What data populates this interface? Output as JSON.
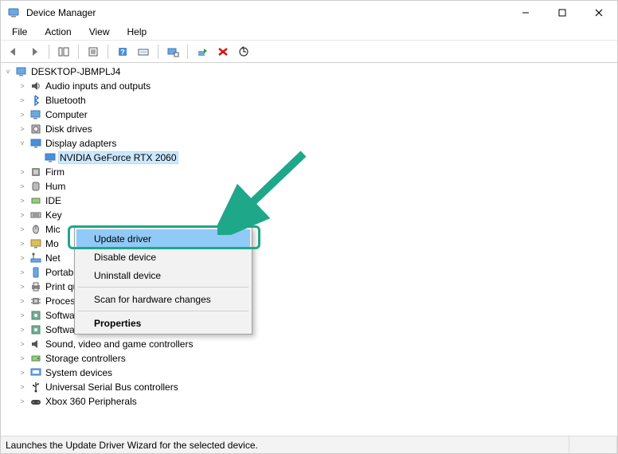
{
  "window": {
    "title": "Device Manager"
  },
  "menu": {
    "items": [
      "File",
      "Action",
      "View",
      "Help"
    ]
  },
  "toolbar": {
    "buttons": [
      {
        "name": "back-icon"
      },
      {
        "name": "forward-icon"
      },
      {
        "sep": true
      },
      {
        "name": "up-icon"
      },
      {
        "sep": true
      },
      {
        "name": "properties-icon"
      },
      {
        "sep": true
      },
      {
        "name": "help-icon"
      },
      {
        "name": "devices-icon"
      },
      {
        "sep": true
      },
      {
        "name": "scan-icon"
      },
      {
        "sep": true
      },
      {
        "name": "add-legacy-icon"
      },
      {
        "name": "uninstall-icon"
      },
      {
        "name": "update-driver-icon"
      }
    ]
  },
  "tree": {
    "root": {
      "label": "DESKTOP-JBMPLJ4",
      "icon": "computer-icon",
      "expanded": true,
      "children": [
        {
          "label": "Audio inputs and outputs",
          "icon": "audio-icon"
        },
        {
          "label": "Bluetooth",
          "icon": "bluetooth-icon"
        },
        {
          "label": "Computer",
          "icon": "computer-icon"
        },
        {
          "label": "Disk drives",
          "icon": "disk-icon"
        },
        {
          "label": "Display adapters",
          "icon": "display-icon",
          "expanded": true,
          "children": [
            {
              "label": "NVIDIA GeForce RTX 2060",
              "icon": "display-icon",
              "selected": true,
              "leaf": true
            }
          ]
        },
        {
          "label": "Firm",
          "icon": "firmware-icon",
          "cut": true
        },
        {
          "label": "Hum",
          "icon": "hid-icon",
          "cut": true
        },
        {
          "label": "IDE",
          "icon": "ide-icon",
          "cut": true
        },
        {
          "label": "Key",
          "icon": "keyboard-icon",
          "cut": true
        },
        {
          "label": "Mic",
          "icon": "mouse-icon",
          "cut": true
        },
        {
          "label": "Mo",
          "icon": "monitor-icon",
          "cut": true
        },
        {
          "label": "Net",
          "icon": "network-icon",
          "cut": true
        },
        {
          "label": "Portable Devices",
          "icon": "portable-icon"
        },
        {
          "label": "Print queues",
          "icon": "printer-icon"
        },
        {
          "label": "Processors",
          "icon": "cpu-icon"
        },
        {
          "label": "Software components",
          "icon": "component-icon"
        },
        {
          "label": "Software devices",
          "icon": "component-icon"
        },
        {
          "label": "Sound, video and game controllers",
          "icon": "sound-icon"
        },
        {
          "label": "Storage controllers",
          "icon": "storage-icon"
        },
        {
          "label": "System devices",
          "icon": "system-icon"
        },
        {
          "label": "Universal Serial Bus controllers",
          "icon": "usb-icon"
        },
        {
          "label": "Xbox 360 Peripherals",
          "icon": "xbox-icon"
        }
      ]
    }
  },
  "context_menu": {
    "items": [
      {
        "label": "Update driver",
        "highlight": true
      },
      {
        "label": "Disable device"
      },
      {
        "label": "Uninstall device"
      },
      {
        "sep": true
      },
      {
        "label": "Scan for hardware changes"
      },
      {
        "sep": true
      },
      {
        "label": "Properties",
        "bold": true
      }
    ]
  },
  "status": {
    "text": "Launches the Update Driver Wizard for the selected device."
  }
}
